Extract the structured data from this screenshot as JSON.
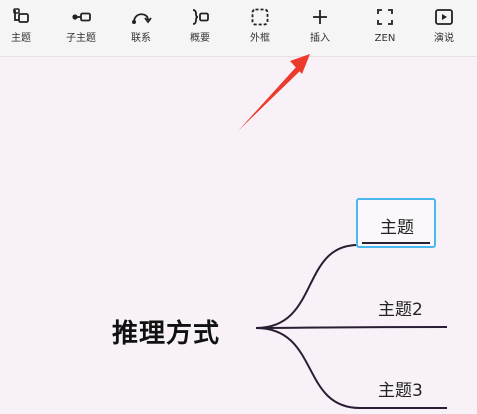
{
  "toolbar": {
    "items": [
      {
        "label": "主题",
        "icon": "topic-icon"
      },
      {
        "label": "子主题",
        "icon": "subtopic-icon"
      },
      {
        "label": "联系",
        "icon": "relationship-icon"
      },
      {
        "label": "概要",
        "icon": "summary-icon"
      },
      {
        "label": "外框",
        "icon": "boundary-icon"
      },
      {
        "label": "插入",
        "icon": "plus-icon"
      },
      {
        "label": "ZEN",
        "icon": "fullscreen-icon"
      },
      {
        "label": "演说",
        "icon": "play-icon"
      }
    ]
  },
  "mindmap": {
    "root": "推理方式",
    "topics": [
      "主题",
      "主题2",
      "主题3"
    ]
  },
  "colors": {
    "branch": "#2b1d33",
    "selection": "#4cb6ef",
    "annotation_arrow": "#ee3a2c",
    "canvas_bg": "#f8f2f8"
  }
}
